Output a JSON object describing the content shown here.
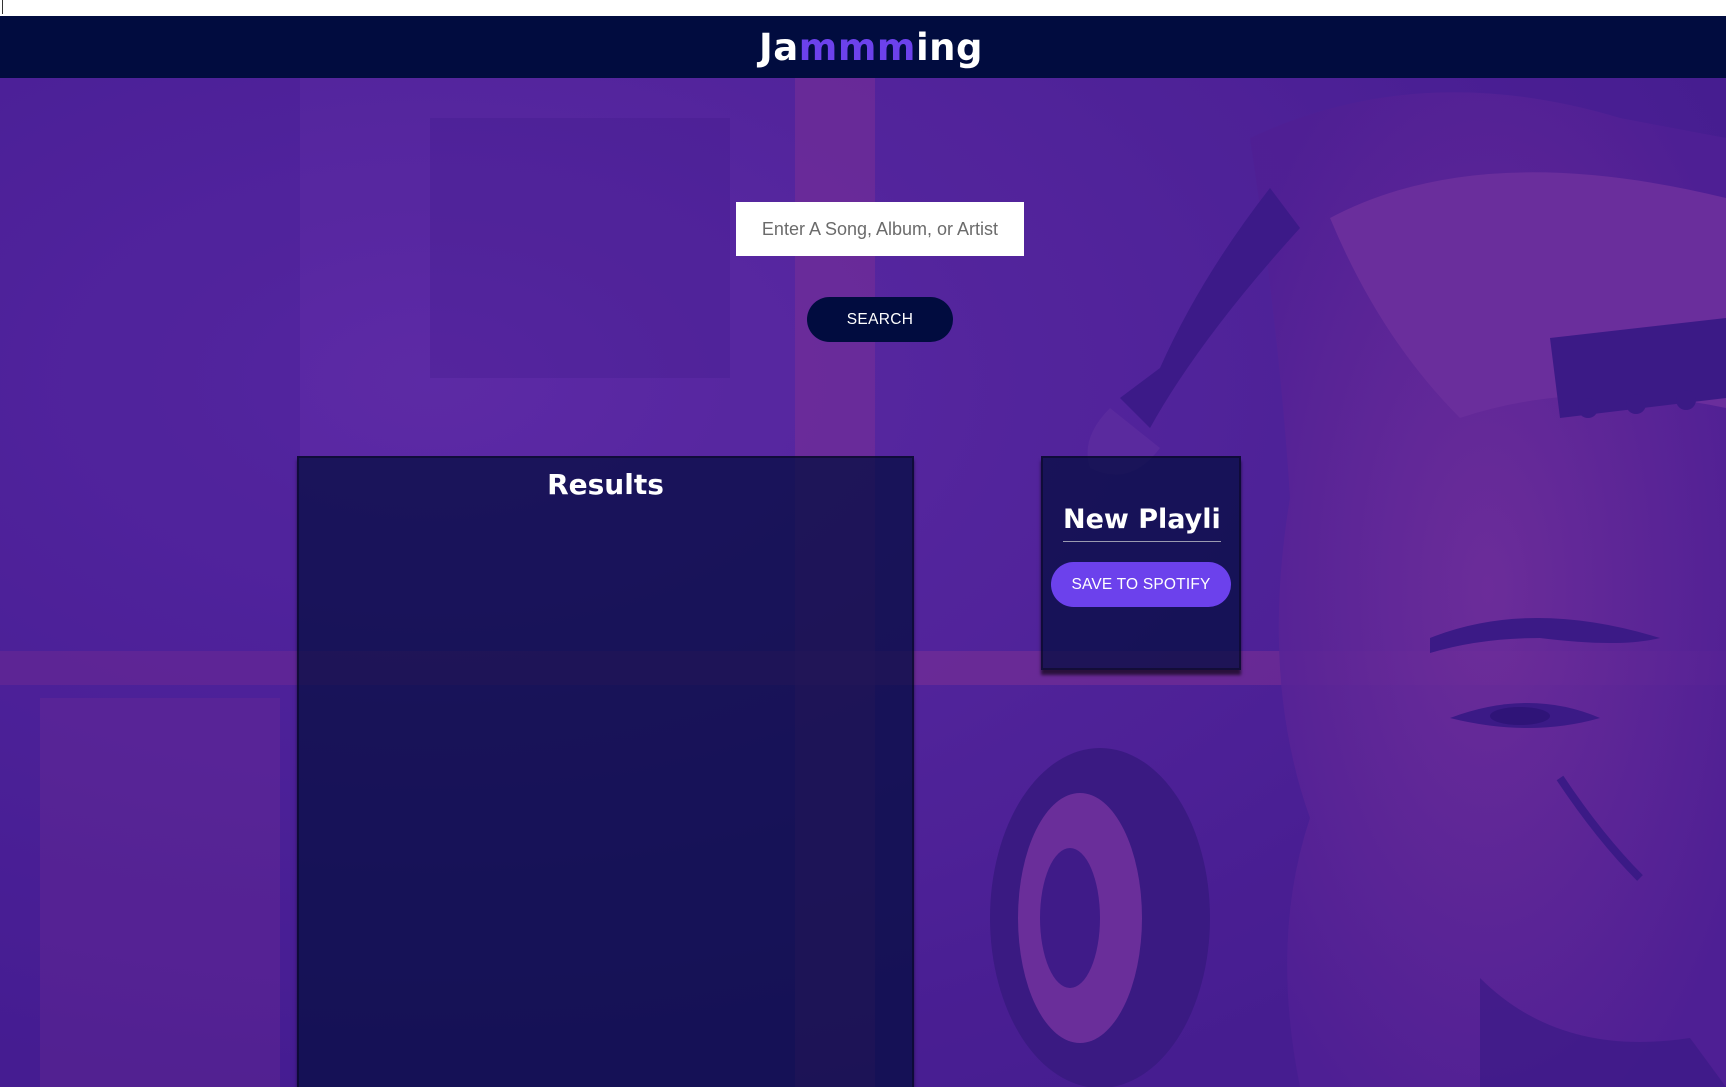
{
  "header": {
    "brand_prefix": "Ja",
    "brand_accent": "mmm",
    "brand_suffix": "ing"
  },
  "search": {
    "placeholder": "Enter A Song, Album, or Artist",
    "value": "",
    "button_label": "SEARCH"
  },
  "results": {
    "title": "Results",
    "tracks": []
  },
  "playlist": {
    "name": "New Playlist",
    "save_label": "SAVE TO SPOTIFY",
    "tracks": []
  },
  "colors": {
    "header_bg": "#010c3f",
    "accent": "#6c41ec",
    "background_tint": "#4a1d9a",
    "panel_bg": "rgba(1, 12, 63, 0.72)"
  }
}
